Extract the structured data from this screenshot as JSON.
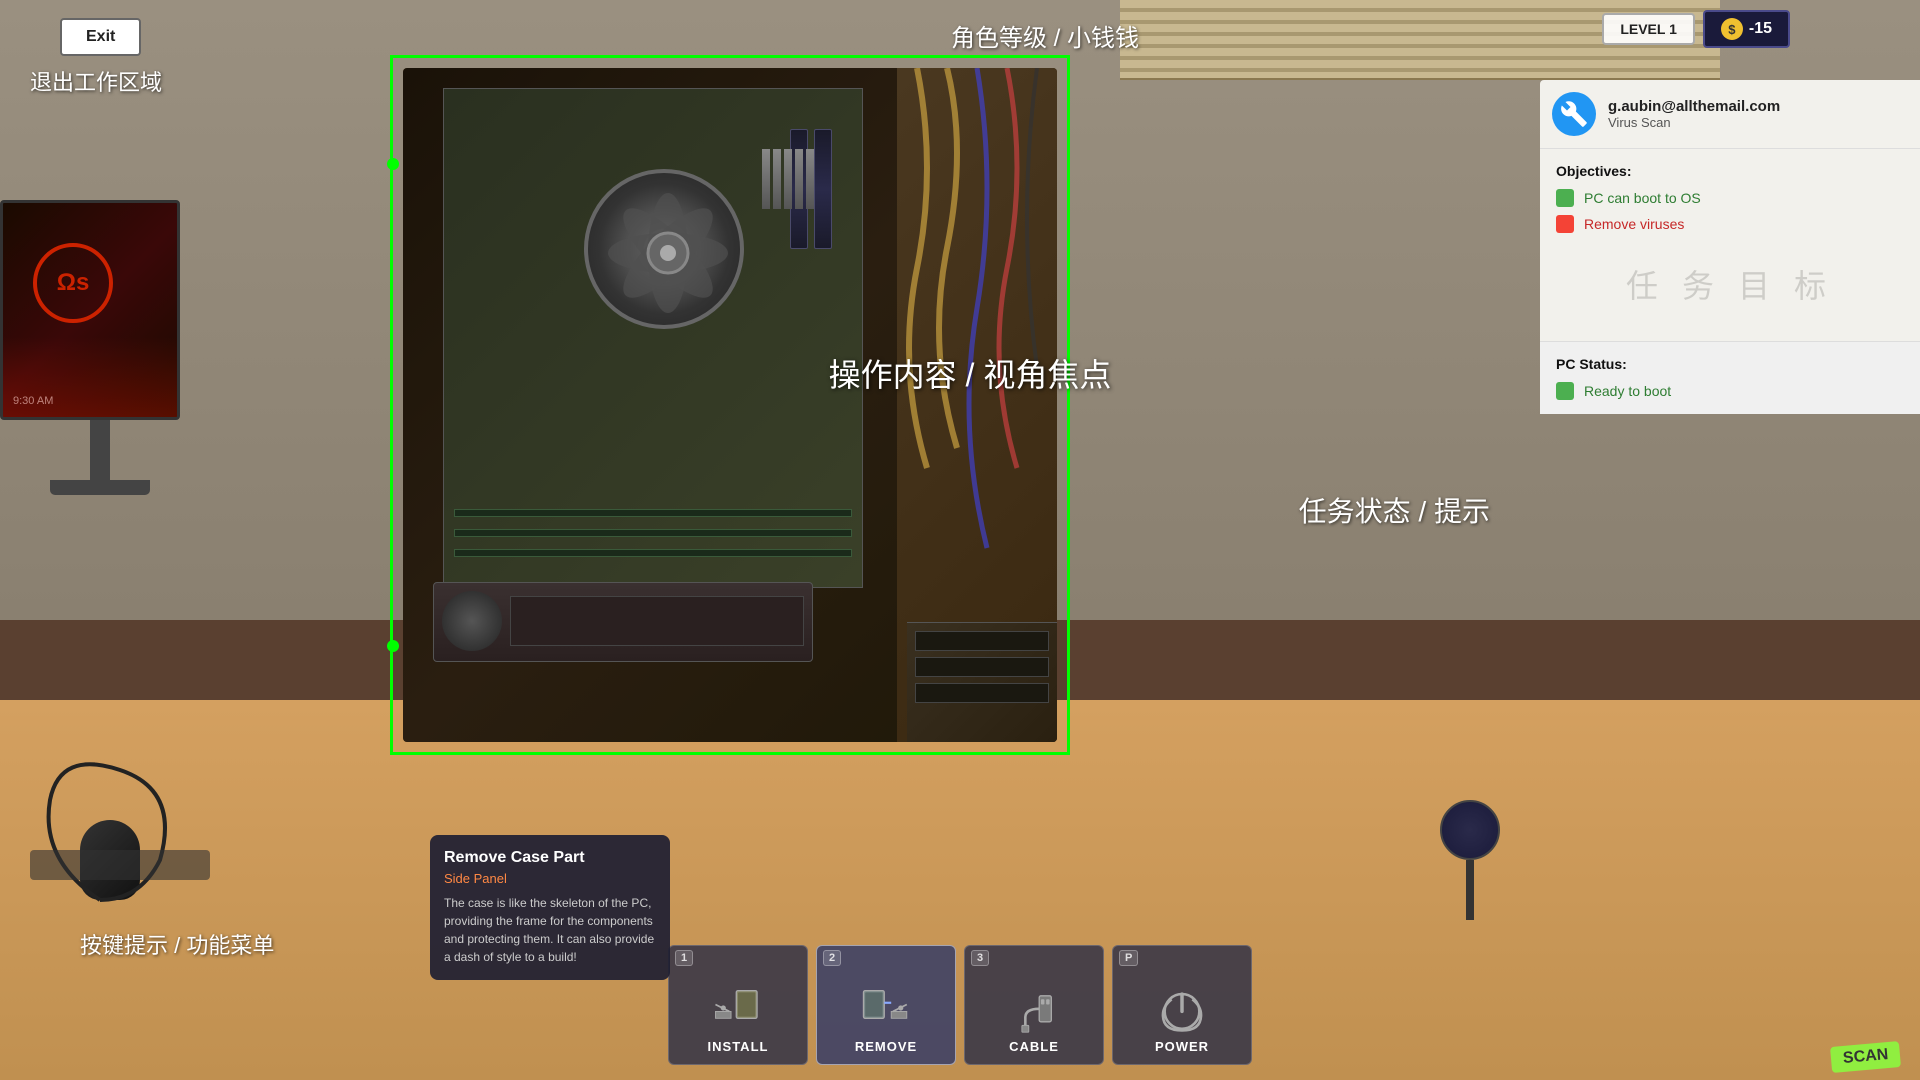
{
  "ui": {
    "exit_button": "Exit",
    "label_exit_area": "退出工作区域",
    "label_rank": "角色等级 / 小钱钱",
    "label_main": "操作内容 / 视角焦点",
    "label_task_status": "任务状态 / 提示",
    "label_hotkeys": "按键提示 / 功能菜单",
    "level": "LEVEL  1",
    "money": "-15",
    "scan_label": "SCAN"
  },
  "panel": {
    "email": "g.aubin@allthemail.com",
    "task_type": "Virus Scan",
    "objectives_title": "Objectives:",
    "objectives": [
      {
        "text": "PC can boot to OS",
        "status": "green"
      },
      {
        "text": "Remove viruses",
        "status": "red"
      }
    ],
    "mission_label": "任 务 目 标",
    "pc_status_title": "PC Status:",
    "pc_status_text": "Ready to boot",
    "task_status_label": "任务状态 / 提示"
  },
  "tooltip": {
    "title": "Remove Case Part",
    "subtitle": "Side Panel",
    "body": "The case is like the skeleton of the PC, providing the frame for the components and protecting them. It can also provide a dash of style to a build!"
  },
  "toolbar": {
    "buttons": [
      {
        "key": "1",
        "label": "INSTALL",
        "active": false
      },
      {
        "key": "2",
        "label": "REMOVE",
        "active": true
      },
      {
        "key": "3",
        "label": "CABLE",
        "active": false
      },
      {
        "key": "P",
        "label": "POWER",
        "active": false
      }
    ]
  },
  "monitor": {
    "logo": "Ωs",
    "time": "9:30 AM"
  }
}
